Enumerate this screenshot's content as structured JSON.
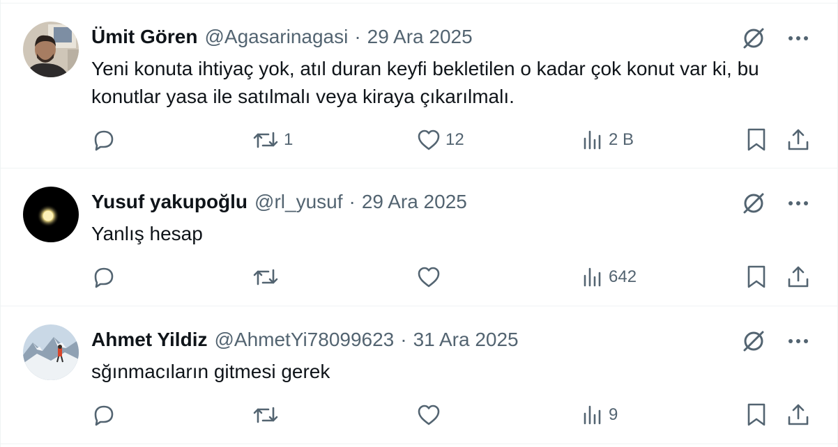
{
  "tweets": [
    {
      "author_name": "Ümit Gören",
      "handle": "@Agasarinagasi",
      "separator": "·",
      "date": "29 Ara 2025",
      "text": "Yeni konuta ihtiyaç yok, atıl duran keyfi bekletilen o kadar çok konut var ki, bu konutlar yasa ile satılmalı veya kiraya çıkarılmalı.",
      "reply_count": "",
      "retweet_count": "1",
      "like_count": "12",
      "view_count": "2 B"
    },
    {
      "author_name": "Yusuf yakupoğlu",
      "handle": "@rl_yusuf",
      "separator": "·",
      "date": "29 Ara 2025",
      "text": "Yanlış hesap",
      "reply_count": "",
      "retweet_count": "",
      "like_count": "",
      "view_count": "642"
    },
    {
      "author_name": "Ahmet Yildiz",
      "handle": "@AhmetYi78099623",
      "separator": "·",
      "date": "31 Ara 2025",
      "text": "sğınmacıların gitmesi gerek",
      "reply_count": "",
      "retweet_count": "",
      "like_count": "",
      "view_count": "9"
    }
  ],
  "icons": {
    "grok": "grok-icon",
    "more": "more-icon",
    "reply": "reply-icon",
    "retweet": "retweet-icon",
    "like": "heart-icon",
    "views": "views-icon",
    "bookmark": "bookmark-icon",
    "share": "share-icon"
  },
  "colors": {
    "text": "#0f1419",
    "secondary": "#536471",
    "divider": "#eff3f4"
  }
}
